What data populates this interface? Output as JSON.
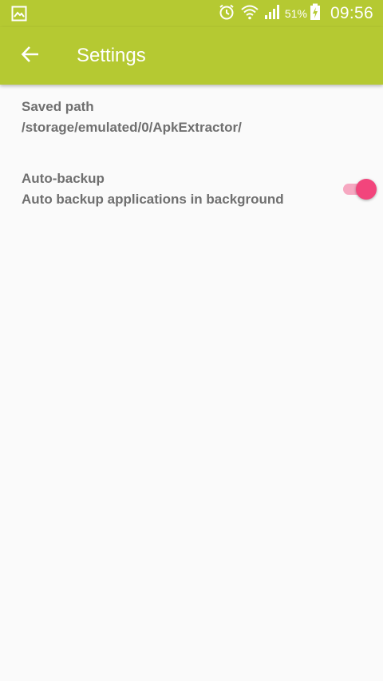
{
  "status_bar": {
    "left_icon": "gallery-notification-icon",
    "icons": [
      "alarm-icon",
      "wifi-icon",
      "signal-icon",
      "battery-charging-icon"
    ],
    "battery_percent": "51%",
    "time": "09:56"
  },
  "app_bar": {
    "back_icon": "arrow-left-icon",
    "title": "Settings",
    "color": "#b5c932"
  },
  "preferences": {
    "saved_path": {
      "title": "Saved path",
      "summary": "/storage/emulated/0/ApkExtractor/"
    },
    "auto_backup": {
      "title": "Auto-backup",
      "summary": "Auto backup applications in background",
      "enabled": true,
      "accent": "#f2457c"
    }
  }
}
